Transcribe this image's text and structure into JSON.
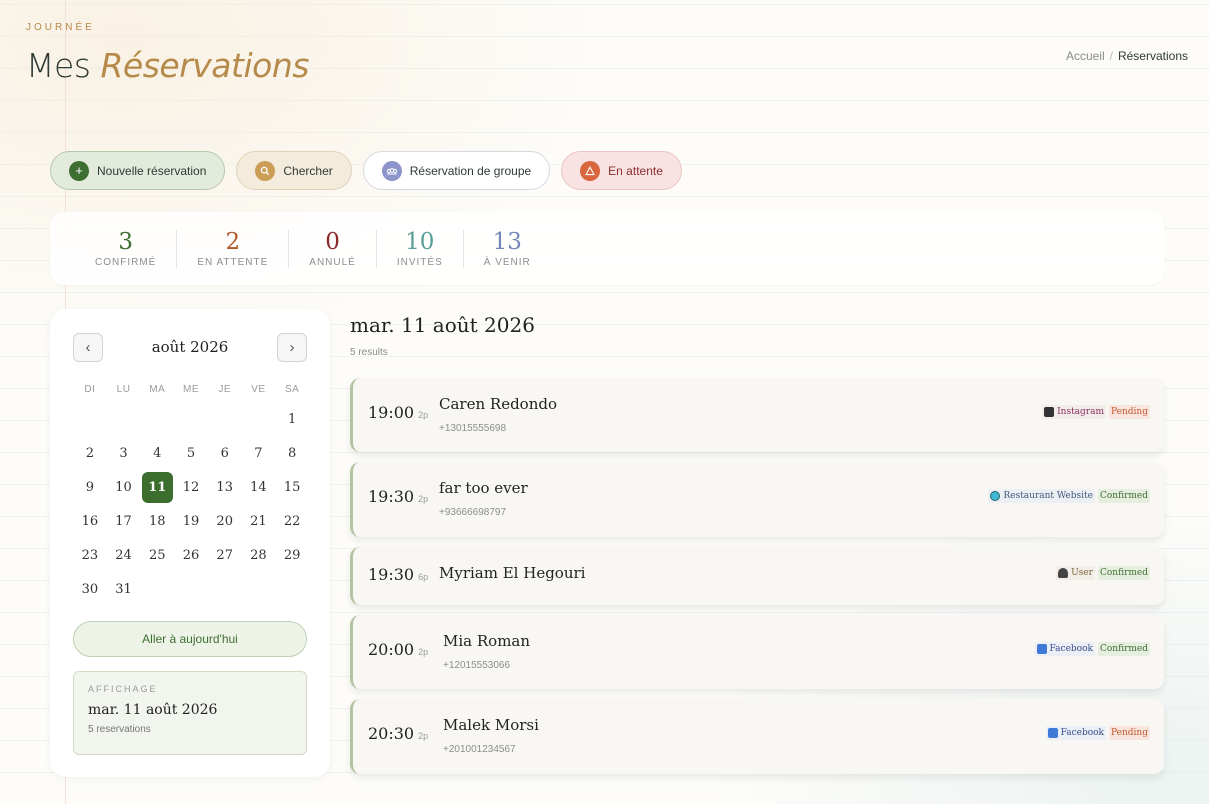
{
  "header": {
    "eyebrow": "JOURNÉE",
    "title_plain": "Mes",
    "title_accent": "Réservations",
    "breadcrumb": {
      "home": "Accueil",
      "separator": "/",
      "current": "Réservations"
    }
  },
  "actions": [
    {
      "label": "Nouvelle réservation",
      "icon": "plus-icon"
    },
    {
      "label": "Chercher",
      "icon": "search-icon"
    },
    {
      "label": "Réservation de groupe",
      "icon": "group-icon"
    },
    {
      "label": "En attente",
      "icon": "warning-icon"
    }
  ],
  "stats": [
    {
      "value": "3",
      "label": "CONFIRMÉ",
      "color": "#3f6e32"
    },
    {
      "value": "2",
      "label": "EN ATTENTE",
      "color": "#b2572a"
    },
    {
      "value": "0",
      "label": "ANNULÉ",
      "color": "#8a2a2a"
    },
    {
      "value": "10",
      "label": "INVITÉS",
      "color": "#5a9e98"
    },
    {
      "value": "13",
      "label": "À VENIR",
      "color": "#7487b8"
    }
  ],
  "calendar": {
    "month": "août 2026",
    "prev": "‹",
    "next": "›",
    "weekdays": [
      "DI",
      "LU",
      "MA",
      "ME",
      "JE",
      "VE",
      "SA"
    ],
    "leading_blanks": 6,
    "days": [
      "1",
      "2",
      "3",
      "4",
      "5",
      "6",
      "7",
      "8",
      "9",
      "10",
      "11",
      "12",
      "13",
      "14",
      "15",
      "16",
      "17",
      "18",
      "19",
      "20",
      "21",
      "22",
      "23",
      "24",
      "25",
      "26",
      "27",
      "28",
      "29",
      "30",
      "31"
    ],
    "selected_day": "11",
    "today_button": "Aller à aujourd'hui",
    "view": {
      "label": "AFFICHAGE",
      "date": "mar. 11 août 2026",
      "count": "5 reservations"
    }
  },
  "list": {
    "title": "mar. 11 août 2026",
    "count": "5 results",
    "reservations": [
      {
        "time": "19:00",
        "party": "2p",
        "name": "Caren Redondo",
        "phone": "+13015555698",
        "source": "Instagram",
        "source_class": "src-insta",
        "source_icon": "camera-icon",
        "status": "Pending",
        "status_class": "st-pending"
      },
      {
        "time": "19:30",
        "party": "2p",
        "name": "far too ever",
        "phone": "+93666698797",
        "source": "Restaurant Website",
        "source_class": "src-web",
        "source_icon": "globe-icon",
        "status": "Confirmed",
        "status_class": "st-confirmed"
      },
      {
        "time": "19:30",
        "party": "6p",
        "name": "Myriam El Hegouri",
        "phone": "",
        "source": "User",
        "source_class": "src-user",
        "source_icon": "user-icon",
        "status": "Confirmed",
        "status_class": "st-confirmed"
      },
      {
        "time": "20:00",
        "party": "2p",
        "name": "Mia Roman",
        "phone": "+12015553066",
        "source": "Facebook",
        "source_class": "src-fb",
        "source_icon": "book-icon",
        "status": "Confirmed",
        "status_class": "st-confirmed"
      },
      {
        "time": "20:30",
        "party": "2p",
        "name": "Malek Morsi",
        "phone": "+201001234567",
        "source": "Facebook",
        "source_class": "src-fb",
        "source_icon": "book-icon",
        "status": "Pending",
        "status_class": "st-pending"
      }
    ]
  }
}
